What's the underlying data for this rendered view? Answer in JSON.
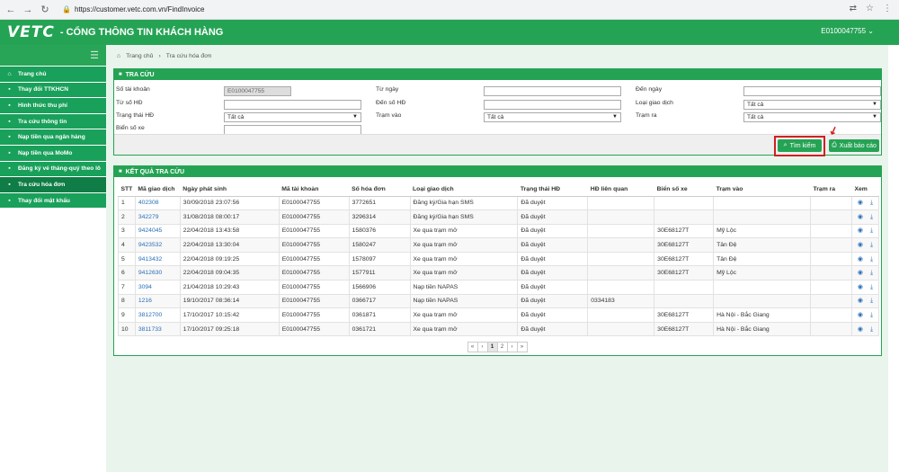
{
  "browser": {
    "url": "https://customer.vetc.com.vn/FindInvoice",
    "icons": [
      "back-icon",
      "forward-icon",
      "reload-icon",
      "lock-icon",
      "translate-icon",
      "star-icon",
      "menu-icon"
    ]
  },
  "header": {
    "logo": "VETC",
    "title": "- CỔNG THÔNG TIN KHÁCH HÀNG",
    "account": "E0100047755"
  },
  "sidebar": {
    "items": [
      {
        "label": "Trang chủ",
        "icon": "home-icon"
      },
      {
        "label": "Thay đổi TTKHCN",
        "icon": "user-icon"
      },
      {
        "label": "Hình thức thu phí",
        "icon": "money-icon"
      },
      {
        "label": "Tra cứu thông tin",
        "icon": "info-icon"
      },
      {
        "label": "Nạp tiền qua ngân hàng",
        "icon": "bank-icon"
      },
      {
        "label": "Nạp tiền qua MoMo",
        "icon": "wallet-icon"
      },
      {
        "label": "Đăng ký vé tháng-quý theo lô",
        "icon": "calendar-icon"
      },
      {
        "label": "Tra cứu hóa đơn",
        "icon": "invoice-icon"
      },
      {
        "label": "Thay đổi mật khẩu",
        "icon": "key-icon"
      }
    ],
    "active_index": 7
  },
  "breadcrumb": {
    "home": "Trang chủ",
    "current": "Tra cứu hóa đơn"
  },
  "search": {
    "title": "TRA CỨU",
    "account_label": "Số tài khoản",
    "account_value": "E0100047755",
    "from_invoice_label": "Từ số HĐ",
    "contract_status_label": "Trạng thái HĐ",
    "contract_status_value": "Tất cả",
    "plate_label": "Biển số xe",
    "from_date_label": "Từ ngày",
    "to_invoice_label": "Đến số HĐ",
    "station_in_label": "Trạm vào",
    "station_in_value": "Tất cả",
    "to_date_label": "Đến ngày",
    "transaction_type_label": "Loại giao dịch",
    "transaction_type_value": "Tất cả",
    "station_out_label": "Trạm ra",
    "station_out_value": "Tất cả",
    "search_button": "Tìm kiếm",
    "report_button": "Xuất báo cáo"
  },
  "results": {
    "title": "KẾT QUẢ TRA CỨU",
    "columns": [
      "STT",
      "Mã giao dịch",
      "Ngày phát sinh",
      "Mã tài khoản",
      "Số hóa đơn",
      "Loại giao dịch",
      "Trạng thái HĐ",
      "HĐ liên quan",
      "Biển số xe",
      "Trạm vào",
      "Trạm ra",
      "Xem"
    ],
    "rows": [
      [
        "1",
        "402308",
        "30/09/2018 23:07:56",
        "E0100047755",
        "3772651",
        "Đăng ký/Gia hạn SMS",
        "Đã duyệt",
        "",
        "",
        "",
        ""
      ],
      [
        "2",
        "342279",
        "31/08/2018 08:00:17",
        "E0100047755",
        "3296314",
        "Đăng ký/Gia hạn SMS",
        "Đã duyệt",
        "",
        "",
        "",
        ""
      ],
      [
        "3",
        "9424045",
        "22/04/2018 13:43:58",
        "E0100047755",
        "1580376",
        "Xe qua trạm mở",
        "Đã duyệt",
        "",
        "30E68127T",
        "Mỹ Lộc",
        ""
      ],
      [
        "4",
        "9423532",
        "22/04/2018 13:30:04",
        "E0100047755",
        "1580247",
        "Xe qua trạm mở",
        "Đã duyệt",
        "",
        "30E68127T",
        "Tân Đệ",
        ""
      ],
      [
        "5",
        "9413432",
        "22/04/2018 09:19:25",
        "E0100047755",
        "1578097",
        "Xe qua trạm mở",
        "Đã duyệt",
        "",
        "30E68127T",
        "Tân Đệ",
        ""
      ],
      [
        "6",
        "9412630",
        "22/04/2018 09:04:35",
        "E0100047755",
        "1577911",
        "Xe qua trạm mở",
        "Đã duyệt",
        "",
        "30E68127T",
        "Mỹ Lộc",
        ""
      ],
      [
        "7",
        "3094",
        "21/04/2018 10:29:43",
        "E0100047755",
        "1566906",
        "Nạp tiền NAPAS",
        "Đã duyệt",
        "",
        "",
        "",
        ""
      ],
      [
        "8",
        "1216",
        "19/10/2017 08:36:14",
        "E0100047755",
        "0366717",
        "Nạp tiền NAPAS",
        "Đã duyệt",
        "0334183",
        "",
        "",
        ""
      ],
      [
        "9",
        "3812700",
        "17/10/2017 10:15:42",
        "E0100047755",
        "0361871",
        "Xe qua trạm mở",
        "Đã duyệt",
        "",
        "30E68127T",
        "Hà Nội - Bắc Giang",
        ""
      ],
      [
        "10",
        "3811733",
        "17/10/2017 09:25:18",
        "E0100047755",
        "0361721",
        "Xe qua trạm mở",
        "Đã duyệt",
        "",
        "30E68127T",
        "Hà Nội - Bắc Giang",
        ""
      ]
    ],
    "pagination": [
      "«",
      "‹",
      "1",
      "2",
      "›",
      "»"
    ],
    "current_page": "1"
  },
  "colors": {
    "brand_green": "#25a355",
    "sidebar_green": "#19a05a",
    "link_blue": "#2a6fb6",
    "highlight_red": "#d21f1f"
  }
}
